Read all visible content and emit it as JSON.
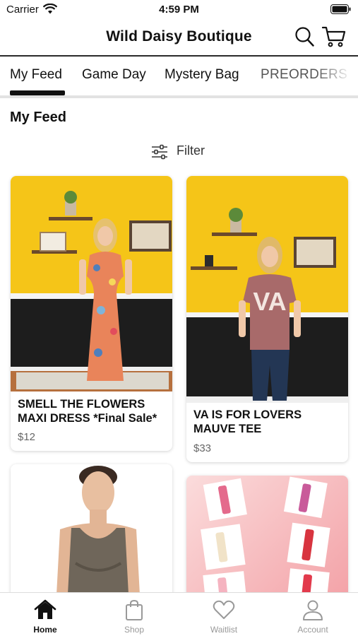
{
  "status_bar": {
    "carrier": "Carrier",
    "time": "4:59 PM"
  },
  "header": {
    "title": "Wild Daisy Boutique"
  },
  "tabs": [
    {
      "label": "My Feed",
      "active": true
    },
    {
      "label": "Game Day",
      "active": false
    },
    {
      "label": "Mystery Bag",
      "active": false
    },
    {
      "label": "PREORDERS",
      "active": false
    }
  ],
  "feed": {
    "title": "My Feed",
    "filter_label": "Filter",
    "products": [
      {
        "name": "SMELL THE FLOWERS MAXI DRESS *Final Sale*",
        "price": "$12"
      },
      {
        "name": "VA IS FOR LOVERS MAUVE TEE",
        "price": "$33"
      },
      {
        "name": "",
        "price": ""
      },
      {
        "name": "",
        "price": ""
      }
    ]
  },
  "bottom_nav": [
    {
      "label": "Home",
      "icon": "home-icon",
      "active": true
    },
    {
      "label": "Shop",
      "icon": "shopping-bag-icon",
      "active": false
    },
    {
      "label": "Waitlist",
      "icon": "heart-icon",
      "active": false
    },
    {
      "label": "Account",
      "icon": "user-icon",
      "active": false
    }
  ],
  "colors": {
    "accent": "#111111",
    "inactive": "#999999",
    "photo_wall": "#f5c518",
    "photo_wainscot": "#1d1d1d"
  }
}
